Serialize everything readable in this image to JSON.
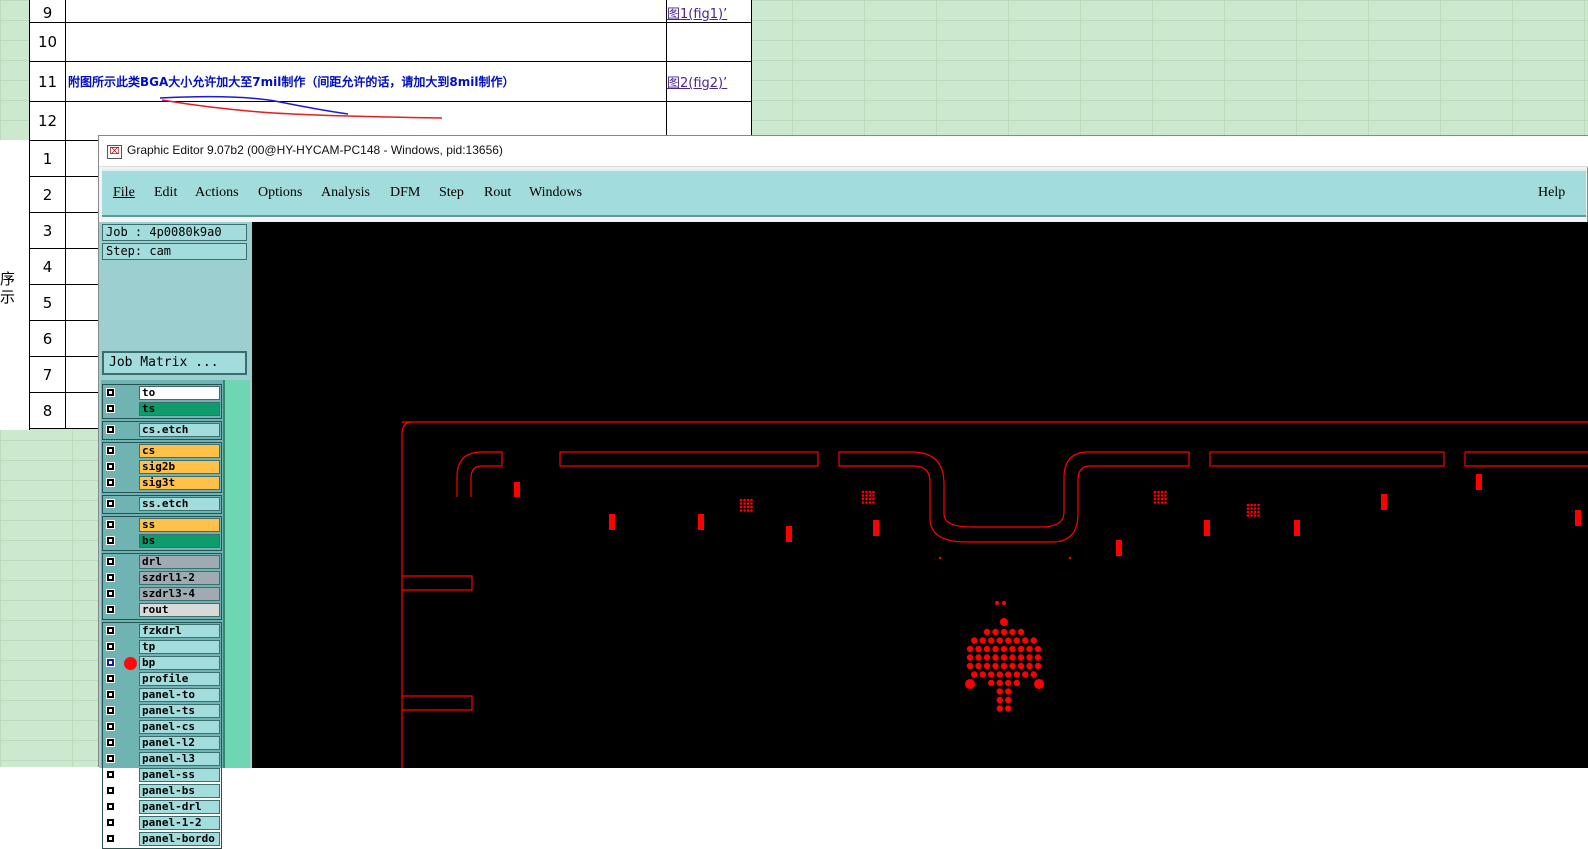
{
  "spreadsheet": {
    "rows_top": [
      {
        "num": "9",
        "content": "",
        "ref": "图1(fig1)’"
      },
      {
        "num": "10",
        "content": "",
        "ref": ""
      },
      {
        "num": "11",
        "content": "附图所示此类BGA大小允许加大至7mil制作（间距允许的话，请加大到8mil制作）",
        "ref": "图2(fig2)’"
      },
      {
        "num": "12",
        "content": "",
        "ref": ""
      }
    ],
    "rows_bottom": [
      "1",
      "2",
      "3",
      "4",
      "5",
      "6",
      "7",
      "8"
    ],
    "side_chars": [
      "序",
      "示"
    ]
  },
  "editor": {
    "title": "Graphic Editor 9.07b2 (00@HY-HYCAM-PC148 - Windows, pid:13656)",
    "menu": [
      "File",
      "Edit",
      "Actions",
      "Options",
      "Analysis",
      "DFM",
      "Step",
      "Rout",
      "Windows"
    ],
    "help": "Help",
    "job_label": "Job : 4p0080k9a0",
    "step_label": "Step: cam",
    "job_matrix": "Job Matrix ...",
    "colors": {
      "teal": "#a3dcdc",
      "orange": "#ffc14a",
      "green": "#0f9c6c",
      "gray": "#9faab3",
      "feature_red": "#ff0000"
    },
    "layers": [
      {
        "name": "to",
        "color": "#ffffff"
      },
      {
        "name": "ts",
        "color": "#0f9c6c"
      },
      {
        "name": "cs.etch",
        "color": "#a3dcdc"
      },
      {
        "name": "cs",
        "color": "#ffc14a"
      },
      {
        "name": "sig2b",
        "color": "#ffc14a"
      },
      {
        "name": "sig3t",
        "color": "#ffc14a"
      },
      {
        "name": "ss.etch",
        "color": "#a3dcdc"
      },
      {
        "name": "ss",
        "color": "#ffc14a"
      },
      {
        "name": "bs",
        "color": "#0f9c6c"
      },
      {
        "name": "drl",
        "color": "#9faab3"
      },
      {
        "name": "szdrl1-2",
        "color": "#9faab3"
      },
      {
        "name": "szdrl3-4",
        "color": "#9faab3"
      },
      {
        "name": "rout",
        "color": "#d9d9d9"
      },
      {
        "name": "fzkdrl",
        "color": "#a3dcdc"
      },
      {
        "name": "tp",
        "color": "#a3dcdc"
      },
      {
        "name": "bp",
        "color": "#a3dcdc",
        "active": true
      },
      {
        "name": "profile",
        "color": "#a3dcdc"
      },
      {
        "name": "panel-to",
        "color": "#a3dcdc"
      },
      {
        "name": "panel-ts",
        "color": "#a3dcdc"
      },
      {
        "name": "panel-cs",
        "color": "#a3dcdc"
      },
      {
        "name": "panel-l2",
        "color": "#a3dcdc"
      },
      {
        "name": "panel-l3",
        "color": "#a3dcdc"
      },
      {
        "name": "panel-ss",
        "color": "#a3dcdc"
      },
      {
        "name": "panel-bs",
        "color": "#a3dcdc"
      },
      {
        "name": "panel-drl",
        "color": "#a3dcdc"
      },
      {
        "name": "panel-1-2",
        "color": "#a3dcdc"
      },
      {
        "name": "panel-bordo",
        "color": "#a3dcdc"
      }
    ]
  }
}
